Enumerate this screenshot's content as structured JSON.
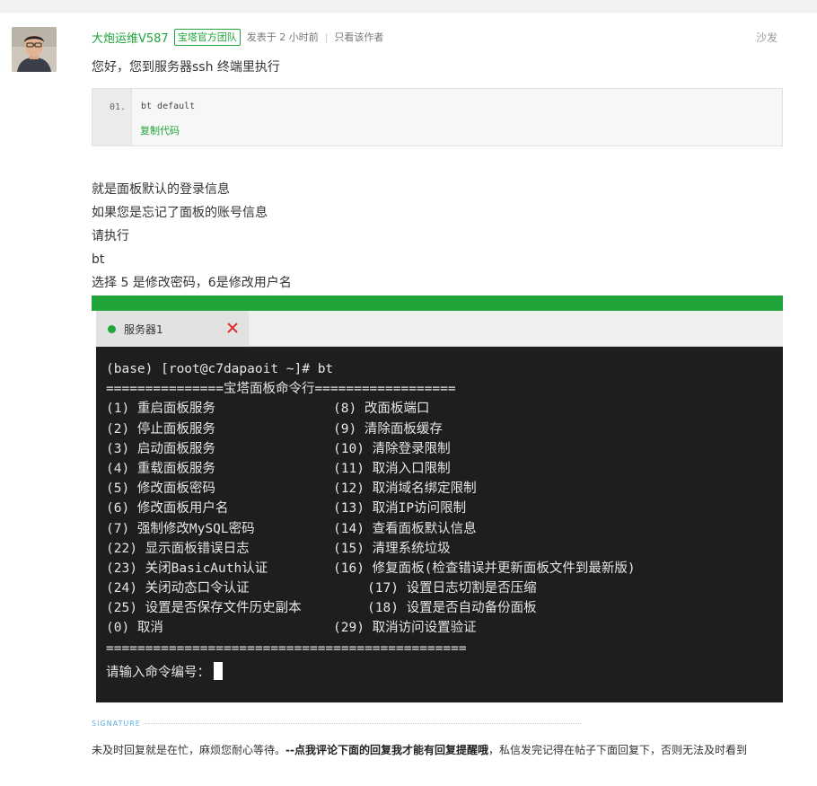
{
  "post": {
    "author": "大炮运维V587",
    "badge": "宝塔官方团队",
    "posted": "发表于 2 小时前",
    "separator": "|",
    "only_author": "只看该作者",
    "floor": "沙发",
    "greeting": "您好，您到服务器ssh 终端里执行",
    "code": {
      "line_no": "01.",
      "line": "bt default",
      "copy_label": "复制代码"
    },
    "lines": [
      "就是面板默认的登录信息",
      "如果您是忘记了面板的账号信息",
      "请执行",
      "bt",
      "选择 5 是修改密码，6是修改用户名"
    ]
  },
  "terminal": {
    "tab_title": "服务器1",
    "prompt": "(base) [root@c7dapaoit ~]# bt",
    "header": "===============宝塔面板命令行==================",
    "menu": [
      [
        "(1) 重启面板服务",
        "(8) 改面板端口"
      ],
      [
        "(2) 停止面板服务",
        "(9) 清除面板缓存"
      ],
      [
        "(3) 启动面板服务",
        "(10) 清除登录限制"
      ],
      [
        "(4) 重载面板服务",
        "(11) 取消入口限制"
      ],
      [
        "(5) 修改面板密码",
        "(12) 取消域名绑定限制"
      ],
      [
        "(6) 修改面板用户名",
        "(13) 取消IP访问限制"
      ],
      [
        "(7) 强制修改MySQL密码",
        "(14) 查看面板默认信息"
      ],
      [
        "(22) 显示面板错误日志",
        "(15) 清理系统垃圾"
      ],
      [
        "(23) 关闭BasicAuth认证",
        "(16) 修复面板(检查错误并更新面板文件到最新版)"
      ],
      [
        "(24) 关闭动态口令认证",
        "(17) 设置日志切割是否压缩"
      ],
      [
        "(25) 设置是否保存文件历史副本",
        "(18) 设置是否自动备份面板"
      ],
      [
        "(0) 取消",
        "(29) 取消访问设置验证"
      ]
    ],
    "footer": "==============================================",
    "input_prompt": "请输入命令编号："
  },
  "signature": {
    "label": "SIGNATURE",
    "text_before": "未及时回复就是在忙，麻烦您耐心等待。",
    "text_bold": "--点我评论下面的回复我才能有回复提醒哦",
    "text_after": "，私信发完记得在帖子下面回复下，否则无法及时看到"
  },
  "colors": {
    "brand_green": "#20a53a",
    "terminal_bg": "#1e1e1e",
    "close_red": "#e02d2d"
  },
  "icons": {
    "status_dot": "green-dot-icon",
    "tab_close": "close-icon"
  }
}
